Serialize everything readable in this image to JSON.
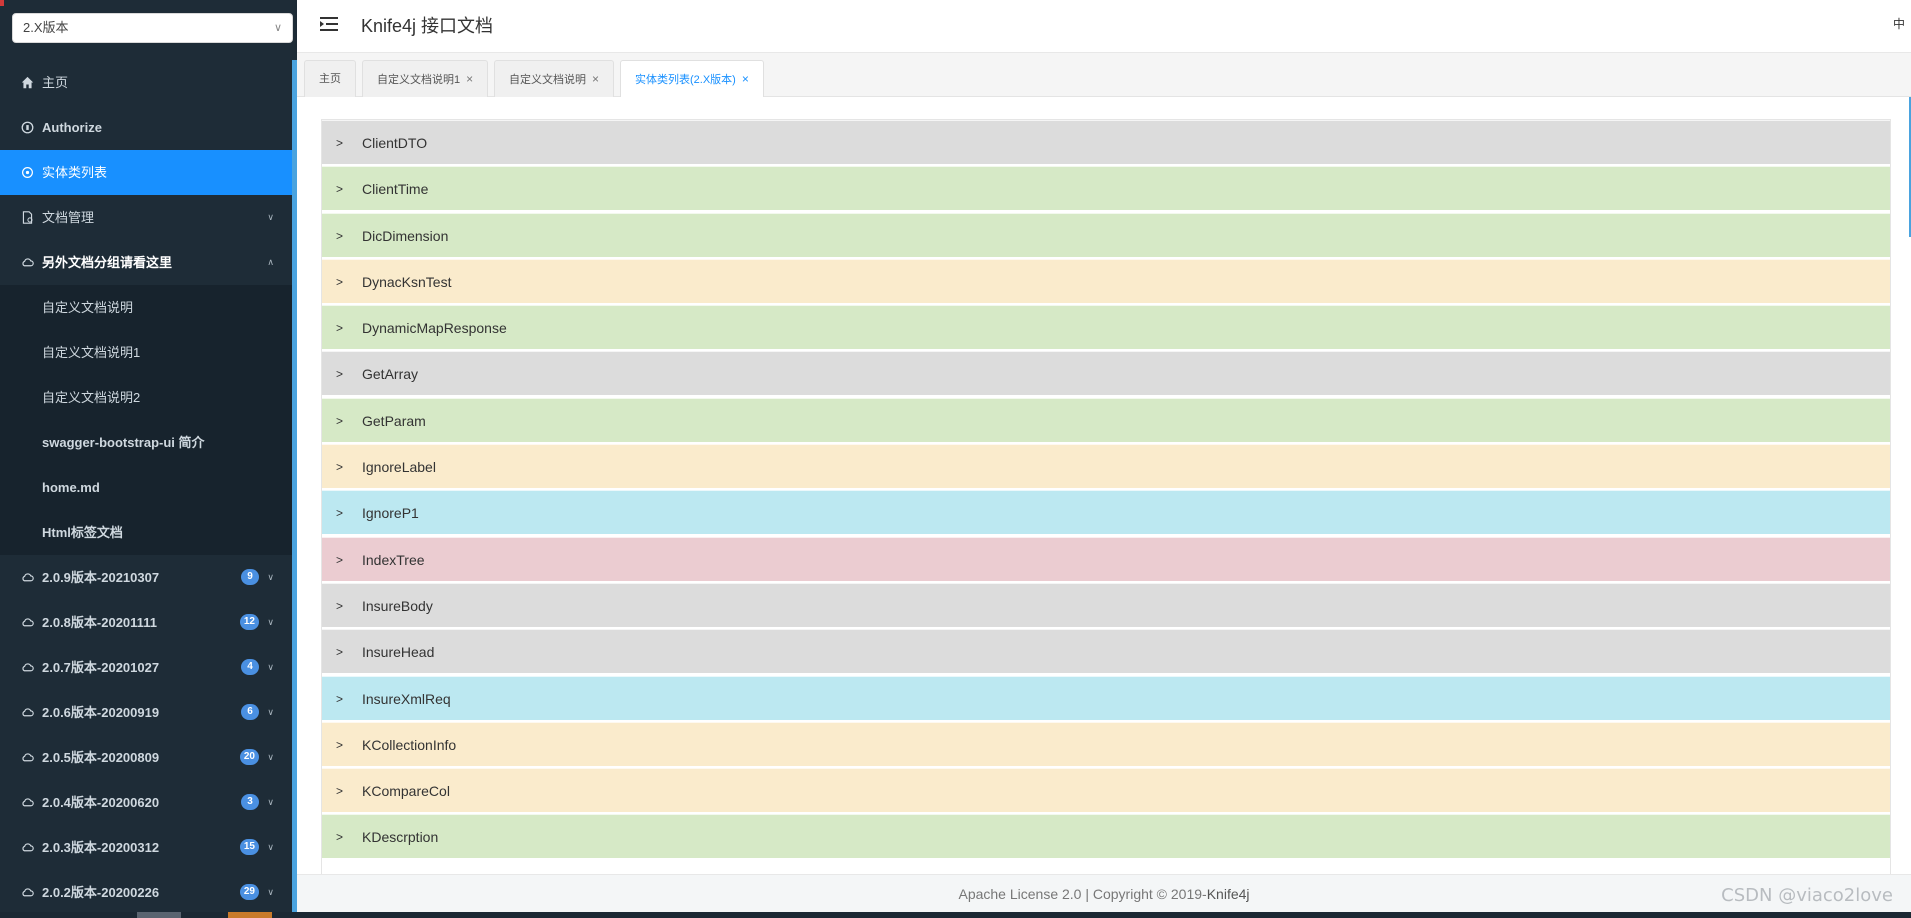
{
  "sidebar": {
    "version_select": {
      "value": "2.X版本"
    },
    "items": [
      {
        "label": "主页",
        "icon": "home-icon"
      },
      {
        "label": "Authorize",
        "icon": "lock-icon"
      },
      {
        "label": "实体类列表",
        "icon": "model-icon",
        "active": true
      },
      {
        "label": "文档管理",
        "icon": "document-icon"
      },
      {
        "label": "另外文档分组请看这里",
        "icon": "cloud-icon"
      }
    ],
    "sub_items": [
      {
        "label": "自定义文档说明"
      },
      {
        "label": "自定义文档说明1"
      },
      {
        "label": "自定义文档说明2"
      },
      {
        "label": "swagger-bootstrap-ui 简介"
      },
      {
        "label": "home.md"
      },
      {
        "label": "Html标签文档"
      }
    ],
    "groups": [
      {
        "label": "2.0.9版本-20210307",
        "badge": "9"
      },
      {
        "label": "2.0.8版本-20201111",
        "badge": "12"
      },
      {
        "label": "2.0.7版本-20201027",
        "badge": "4"
      },
      {
        "label": "2.0.6版本-20200919",
        "badge": "6"
      },
      {
        "label": "2.0.5版本-20200809",
        "badge": "20"
      },
      {
        "label": "2.0.4版本-20200620",
        "badge": "3"
      },
      {
        "label": "2.0.3版本-20200312",
        "badge": "15"
      },
      {
        "label": "2.0.2版本-20200226",
        "badge": "29"
      }
    ]
  },
  "header": {
    "title": "Knife4j 接口文档",
    "lang": "中"
  },
  "tabs": [
    {
      "label": "主页"
    },
    {
      "label": "自定义文档说明1",
      "close": "×"
    },
    {
      "label": "自定义文档说明",
      "close": "×"
    },
    {
      "label": "实体类列表(2.X版本)",
      "close": "×",
      "active": true
    }
  ],
  "models": [
    {
      "name": "ClientDTO",
      "color": "#dcdcdc"
    },
    {
      "name": "ClientTime",
      "color": "#d6e9c6"
    },
    {
      "name": "DicDimension",
      "color": "#d6e9c6"
    },
    {
      "name": "DynacKsnTest",
      "color": "#faebcc"
    },
    {
      "name": "DynamicMapResponse",
      "color": "#d6e9c6"
    },
    {
      "name": "GetArray",
      "color": "#dcdcdc"
    },
    {
      "name": "GetParam",
      "color": "#d6e9c6"
    },
    {
      "name": "IgnoreLabel",
      "color": "#faebcc"
    },
    {
      "name": "IgnoreP1",
      "color": "#bce8f1"
    },
    {
      "name": "IndexTree",
      "color": "#ebccd1"
    },
    {
      "name": "InsureBody",
      "color": "#dcdcdc"
    },
    {
      "name": "InsureHead",
      "color": "#dcdcdc"
    },
    {
      "name": "InsureXmlReq",
      "color": "#bce8f1"
    },
    {
      "name": "KCollectionInfo",
      "color": "#faebcc"
    },
    {
      "name": "KCompareCol",
      "color": "#faebcc"
    },
    {
      "name": "KDescrption",
      "color": "#d6e9c6"
    }
  ],
  "footer": {
    "text": "Apache License 2.0 | Copyright © 2019-",
    "brand": "Knife4j"
  },
  "watermark": "CSDN @viaco2love",
  "colors": {
    "sidebar_bg": "#1e2c37",
    "active_blue": "#1890ff",
    "badge_blue": "#4a90e2"
  }
}
